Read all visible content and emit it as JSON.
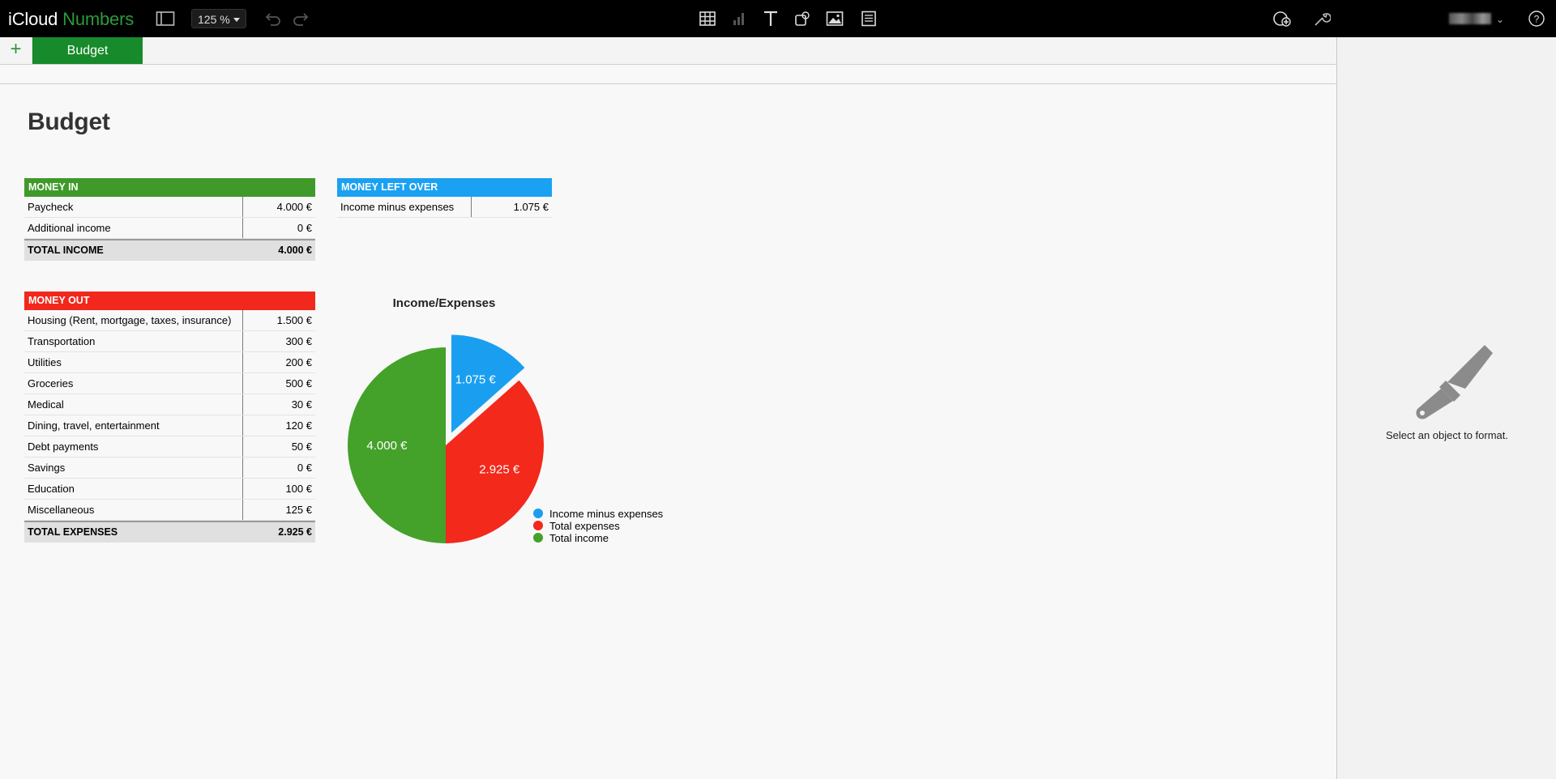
{
  "app": {
    "brand": "iCloud",
    "app_name": "Numbers"
  },
  "toolbar": {
    "zoom": "125 %",
    "icons": [
      "sidebar-icon",
      "undo-icon",
      "redo-icon",
      "table-icon",
      "chart-icon",
      "text-icon",
      "shape-icon",
      "media-icon",
      "comment-icon",
      "collaborate-icon",
      "tools-icon",
      "help-icon"
    ]
  },
  "tabs": {
    "add_label": "+",
    "sheet_label": "Budget"
  },
  "sheet_title": "Budget",
  "money_in": {
    "header": "MONEY IN",
    "color": "#3f9a2a",
    "rows": [
      {
        "label": "Paycheck",
        "value": "4.000 €"
      },
      {
        "label": "Additional income",
        "value": "0 €"
      }
    ],
    "total": {
      "label": "TOTAL INCOME",
      "value": "4.000 €"
    }
  },
  "money_left": {
    "header": "MONEY LEFT OVER",
    "color": "#1ba1f2",
    "rows": [
      {
        "label": "Income minus expenses",
        "value": "1.075 €"
      }
    ]
  },
  "money_out": {
    "header": "MONEY OUT",
    "color": "#f1281b",
    "rows": [
      {
        "label": "Housing (Rent, mortgage, taxes, insurance)",
        "value": "1.500 €"
      },
      {
        "label": "Transportation",
        "value": "300 €"
      },
      {
        "label": "Utilities",
        "value": "200 €"
      },
      {
        "label": "Groceries",
        "value": "500 €"
      },
      {
        "label": "Medical",
        "value": "30 €"
      },
      {
        "label": "Dining, travel, entertainment",
        "value": "120 €"
      },
      {
        "label": "Debt payments",
        "value": "50 €"
      },
      {
        "label": "Savings",
        "value": "0 €"
      },
      {
        "label": "Education",
        "value": "100 €"
      },
      {
        "label": "Miscellaneous",
        "value": "125 €"
      }
    ],
    "total": {
      "label": "TOTAL EXPENSES",
      "value": "2.925 €"
    }
  },
  "chart_data": {
    "type": "pie",
    "title": "Income/Expenses",
    "categories": [
      "Income minus expenses",
      "Total expenses",
      "Total income"
    ],
    "values": [
      1075,
      2925,
      4000
    ],
    "data_labels": [
      "1.075 €",
      "2.925 €",
      "4.000 €"
    ],
    "colors": [
      "#1a9ff0",
      "#f2291b",
      "#44a12a"
    ],
    "exploded": [
      true,
      false,
      false
    ],
    "legend_position": "bottom-right"
  },
  "inspector": {
    "message": "Select an object to format."
  }
}
